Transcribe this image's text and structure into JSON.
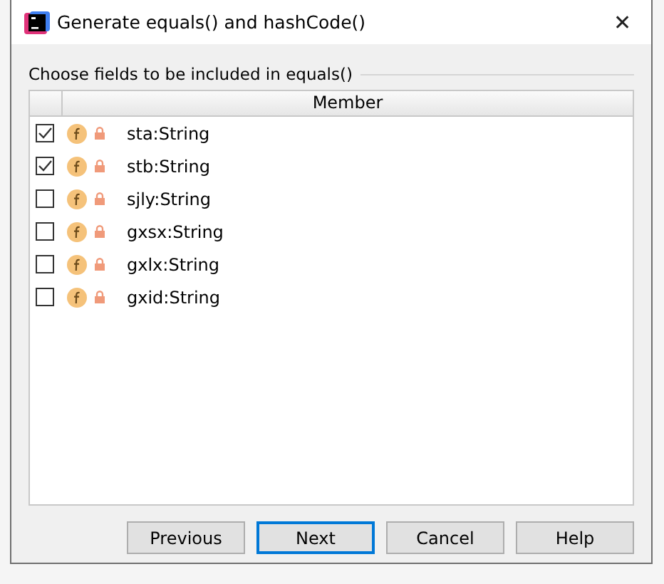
{
  "window": {
    "title": "Generate equals() and hashCode()",
    "close": "✕"
  },
  "group_label": "Choose fields to be included in equals()",
  "table": {
    "columns": [
      "Member"
    ],
    "rows": [
      {
        "name": "sta:String",
        "checked": true
      },
      {
        "name": "stb:String",
        "checked": true
      },
      {
        "name": "sjly:String",
        "checked": false
      },
      {
        "name": "gxsx:String",
        "checked": false
      },
      {
        "name": "gxlx:String",
        "checked": false
      },
      {
        "name": "gxid:String",
        "checked": false
      }
    ]
  },
  "buttons": [
    {
      "label": "Previous",
      "selected": false
    },
    {
      "label": "Next",
      "selected": true
    },
    {
      "label": "Cancel",
      "selected": false
    },
    {
      "label": "Help",
      "selected": false
    }
  ]
}
